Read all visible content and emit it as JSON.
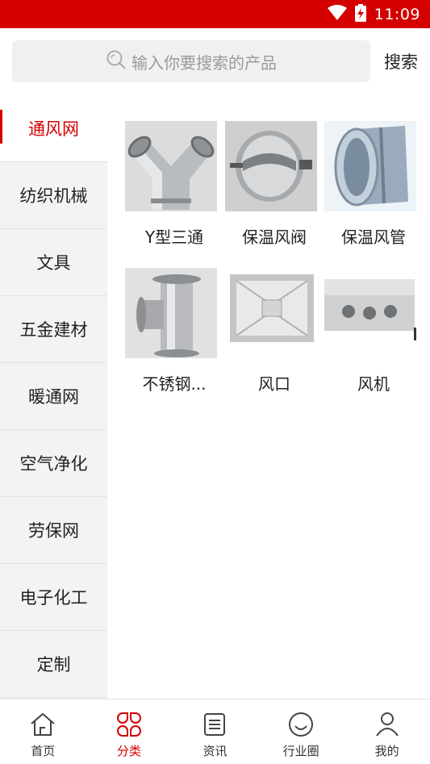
{
  "colors": {
    "accent": "#d40000",
    "sidebar_bg": "#f3f3f3",
    "search_bg": "#f0f0f0"
  },
  "status_bar": {
    "time": "11:09",
    "icons": [
      "wifi-icon",
      "battery-charging-icon"
    ]
  },
  "search": {
    "placeholder": "输入你要搜索的产品",
    "button_label": "搜索",
    "icon": "search-icon"
  },
  "sidebar": {
    "selected_index": 0,
    "items": [
      {
        "label": "通风网"
      },
      {
        "label": "纺织机械"
      },
      {
        "label": "文具"
      },
      {
        "label": "五金建材"
      },
      {
        "label": "暖通网"
      },
      {
        "label": "空气净化"
      },
      {
        "label": "劳保网"
      },
      {
        "label": "电子化工"
      },
      {
        "label": "定制"
      }
    ]
  },
  "products": [
    {
      "name": "Y型三通",
      "image": "y-tee-duct-image"
    },
    {
      "name": "保温风阀",
      "image": "damper-valve-image"
    },
    {
      "name": "保温风管",
      "image": "insulated-duct-image"
    },
    {
      "name": "不锈钢...",
      "image": "stainless-tee-image"
    },
    {
      "name": "风口",
      "image": "air-vent-image"
    },
    {
      "name": "风机",
      "image": "fan-box-image"
    }
  ],
  "bottom_nav": {
    "selected_index": 1,
    "items": [
      {
        "label": "首页",
        "icon": "home-icon"
      },
      {
        "label": "分类",
        "icon": "category-icon"
      },
      {
        "label": "资讯",
        "icon": "news-icon"
      },
      {
        "label": "行业圈",
        "icon": "circle-icon"
      },
      {
        "label": "我的",
        "icon": "profile-icon"
      }
    ]
  }
}
